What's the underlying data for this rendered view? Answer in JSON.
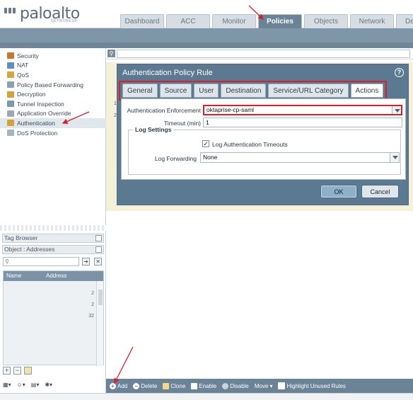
{
  "brand": {
    "name": "paloalto",
    "sub": "NETWORKS®"
  },
  "nav_tabs": [
    "Dashboard",
    "ACC",
    "Monitor",
    "Policies",
    "Objects",
    "Network",
    "Dev"
  ],
  "active_tab": "Policies",
  "sidebar": {
    "items": [
      {
        "label": "Security",
        "icon": "security-icon"
      },
      {
        "label": "NAT",
        "icon": "nat-icon"
      },
      {
        "label": "QoS",
        "icon": "qos-icon"
      },
      {
        "label": "Policy Based Forwarding",
        "icon": "pbf-icon"
      },
      {
        "label": "Decryption",
        "icon": "decryption-icon"
      },
      {
        "label": "Tunnel Inspection",
        "icon": "tunnel-icon"
      },
      {
        "label": "Application Override",
        "icon": "app-override-icon"
      },
      {
        "label": "Authentication",
        "icon": "authentication-icon"
      },
      {
        "label": "DoS Protection",
        "icon": "dos-icon"
      }
    ],
    "selected": "Authentication",
    "tag_browser": "Tag Browser",
    "object_panel": "Object : Addresses",
    "grid_headers": [
      "Name",
      "Address"
    ],
    "grid_numbers": [
      "2",
      "2",
      "32"
    ],
    "footer_tools": [
      "▾",
      "▾",
      "▾",
      "▾"
    ]
  },
  "rule_rows": [
    "1",
    "2"
  ],
  "dialog": {
    "title": "Authentication Policy Rule",
    "tabs": [
      "General",
      "Source",
      "User",
      "Destination",
      "Service/URL Category",
      "Actions"
    ],
    "active_tab": "Actions",
    "auth_enforcement_label": "Authentication Enforcement",
    "auth_enforcement_value": "oktaprise-cp-saml",
    "timeout_label": "Timeout (min)",
    "timeout_value": "1",
    "log_settings_label": "Log Settings",
    "log_timeouts_label": "Log Authentication Timeouts",
    "log_timeouts_checked": true,
    "log_forwarding_label": "Log Forwarding",
    "log_forwarding_value": "None",
    "ok_label": "OK",
    "cancel_label": "Cancel"
  },
  "toolbar": {
    "add": "Add",
    "delete": "Delete",
    "clone": "Clone",
    "enable": "Enable",
    "disable": "Disable",
    "move": "Move",
    "highlight": "Highlight Unused Rules"
  },
  "colors": {
    "accent": "#6a8397",
    "highlight": "#d8202a",
    "rule_bg": "#f4f0d9"
  }
}
